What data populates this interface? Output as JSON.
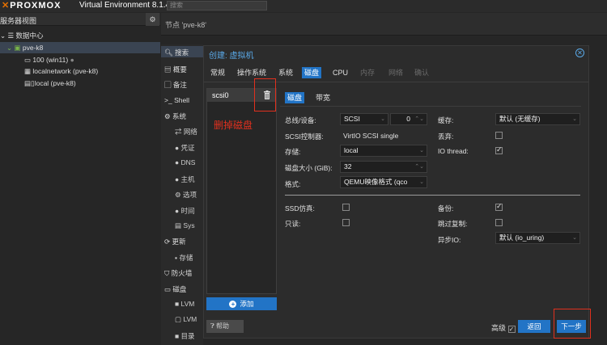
{
  "header": {
    "logo": "PROXMOX",
    "version": "Virtual Environment 8.1.4",
    "search_placeholder": "搜索"
  },
  "tree": {
    "view_label": "服务器视图",
    "items": [
      {
        "label": "数据中心"
      },
      {
        "label": "pve-k8"
      },
      {
        "label": "100 (win11)"
      },
      {
        "label": "localnetwork (pve-k8)"
      },
      {
        "label": "local (pve-k8)"
      }
    ]
  },
  "node_header": "节点 'pve-k8'",
  "side_menu": {
    "items": [
      "搜索",
      "概要",
      "备注",
      "Shell",
      "系统",
      "网络",
      "凭证",
      "DNS",
      "主机",
      "选项",
      "时间",
      "Sys",
      "更新",
      "存储",
      "防火墙",
      "磁盘",
      "LVM",
      "LVM",
      "目录"
    ]
  },
  "dialog": {
    "title": "创建: 虚拟机",
    "tabs": [
      "常规",
      "操作系统",
      "系统",
      "磁盘",
      "CPU",
      "内存",
      "网络",
      "确认"
    ],
    "active_tab": "磁盘",
    "disks": [
      "scsi0"
    ],
    "add_label": "添加",
    "annotation": "删掉磁盘",
    "subtabs": [
      "磁盘",
      "带宽"
    ],
    "form": {
      "bus_label": "总线/设备:",
      "bus_value": "SCSI",
      "bus_index": "0",
      "scsi_ctrl_label": "SCSI控制器:",
      "scsi_ctrl_value": "VirtIO SCSI single",
      "storage_label": "存储:",
      "storage_value": "local",
      "size_label": "磁盘大小 (GiB):",
      "size_value": "32",
      "format_label": "格式:",
      "format_value": "QEMU映像格式 (qco",
      "cache_label": "缓存:",
      "cache_value": "默认 (无缓存)",
      "discard_label": "丢弃:",
      "iothread_label": "IO thread:",
      "ssd_label": "SSD仿真:",
      "readonly_label": "只读:",
      "backup_label": "备份:",
      "skip_repl_label": "跳过复制:",
      "async_io_label": "异步IO:",
      "async_io_value": "默认 (io_uring)"
    },
    "footer": {
      "help": "帮助",
      "advanced": "高级",
      "back": "返回",
      "next": "下一步"
    }
  }
}
